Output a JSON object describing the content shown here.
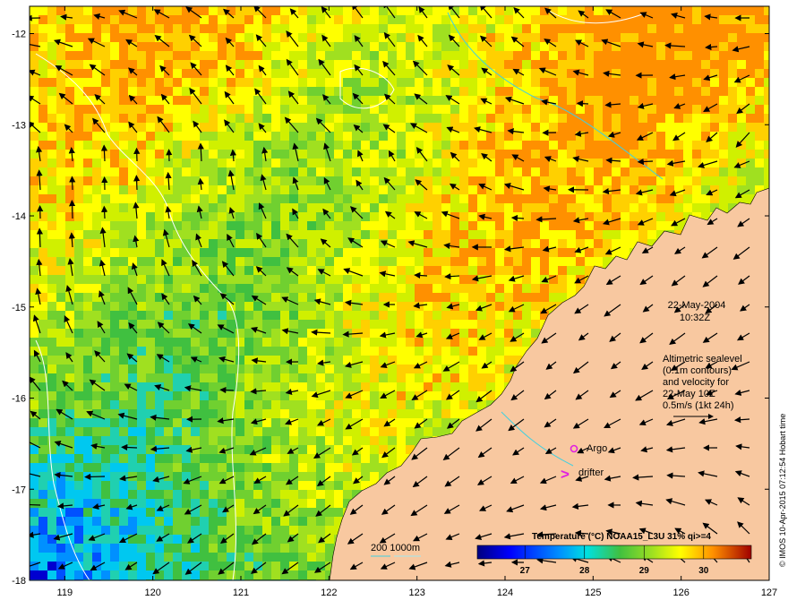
{
  "map": {
    "date": "22-May-2004",
    "time": "10:32Z",
    "altimetry_note": [
      "Altimetric sealevel",
      "(0.1m contours)",
      "and velocity for",
      "22-May 10Z",
      "0.5m/s (1kt 24h)"
    ],
    "argo_label": "Argo",
    "drifter_label": "drifter",
    "drifter_symbol": ">",
    "depth_legend": "200  1000m",
    "credit": "© IMOS 10-Apr-2015 07:12:54 Hobart time",
    "lon_ticks": [
      "119",
      "120",
      "121",
      "122",
      "123",
      "124",
      "125",
      "126",
      "127"
    ],
    "lat_ticks": [
      "-12",
      "-13",
      "-14",
      "-15",
      "-16",
      "-17",
      "-18"
    ],
    "lon_range": [
      118.6,
      127.0
    ],
    "lat_range": [
      -18.0,
      -11.7
    ]
  },
  "colorbar": {
    "title": "Temperature (°C) NOAA15_L3U 31% qi>=4",
    "ticks": [
      "27",
      "28",
      "29",
      "30"
    ],
    "range": [
      26.2,
      30.8
    ]
  },
  "colors": {
    "land": "#f8c8a0",
    "isobath_200": "#40d0e0",
    "isobath_1000": "#a0e8f0",
    "contour": "#ffffff",
    "arrow": "#000000",
    "argo": "#e020e0",
    "drifter": "#e020e0"
  }
}
